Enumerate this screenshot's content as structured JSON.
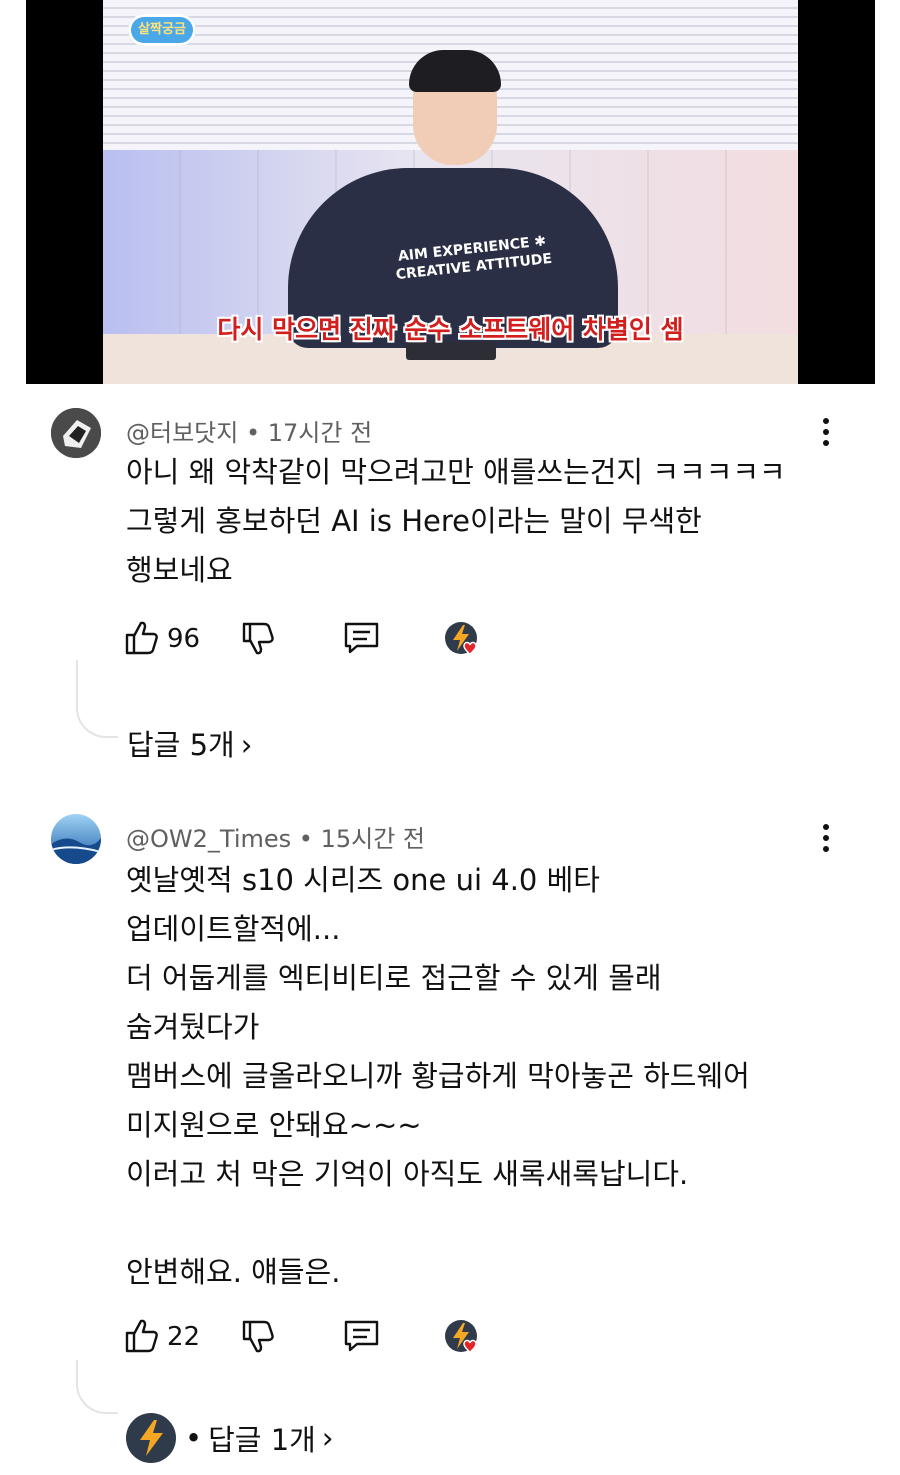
{
  "video": {
    "channel_logo_text": "살짝궁금",
    "shirt_line1": "AIM EXPERIENCE ✱",
    "shirt_line2": "CREATIVE ATTITUDE",
    "subtitle": "다시 막으면 진짜 순수 소프트웨어 차별인 셈"
  },
  "comments": [
    {
      "author": "@터보닷지",
      "separator": "•",
      "time": "17시간 전",
      "text": "아니 왜 악착같이 막으려고만 애를쓰는건지 ㅋㅋㅋㅋㅋ\n그렇게 홍보하던 AI is Here이라는 말이 무색한\n행보네요",
      "likes": "96",
      "replies_label": "답글 5개",
      "chevron": "›"
    },
    {
      "author": "@OW2_Times",
      "separator": "•",
      "time": "15시간 전",
      "text": "옛날옛적 s10 시리즈 one ui 4.0 베타\n업데이트할적에...\n더 어둡게를 엑티비티로 접근할 수 있게 몰래\n숨겨뒀다가\n맴버스에 글올라오니까 황급하게 막아놓곤 하드웨어\n미지원으로 안돼요~~~\n이러고 처 막은 기억이 아직도 새록새록납니다.\n\n안변해요. 얘들은.",
      "likes": "22",
      "replies_prefix": "•",
      "replies_label": "답글 1개",
      "chevron": "›"
    }
  ],
  "icons": {
    "like": "thumbs-up-icon",
    "dislike": "thumbs-down-icon",
    "reply": "comment-icon",
    "creator_heart": "creator-heart-icon",
    "more": "more-vert-icon"
  },
  "colors": {
    "heart": "#e3242b",
    "creator_avatar_bg": "#2f3a4a",
    "bolt": "#f5a623",
    "subtitle_red": "#d31e1e"
  }
}
